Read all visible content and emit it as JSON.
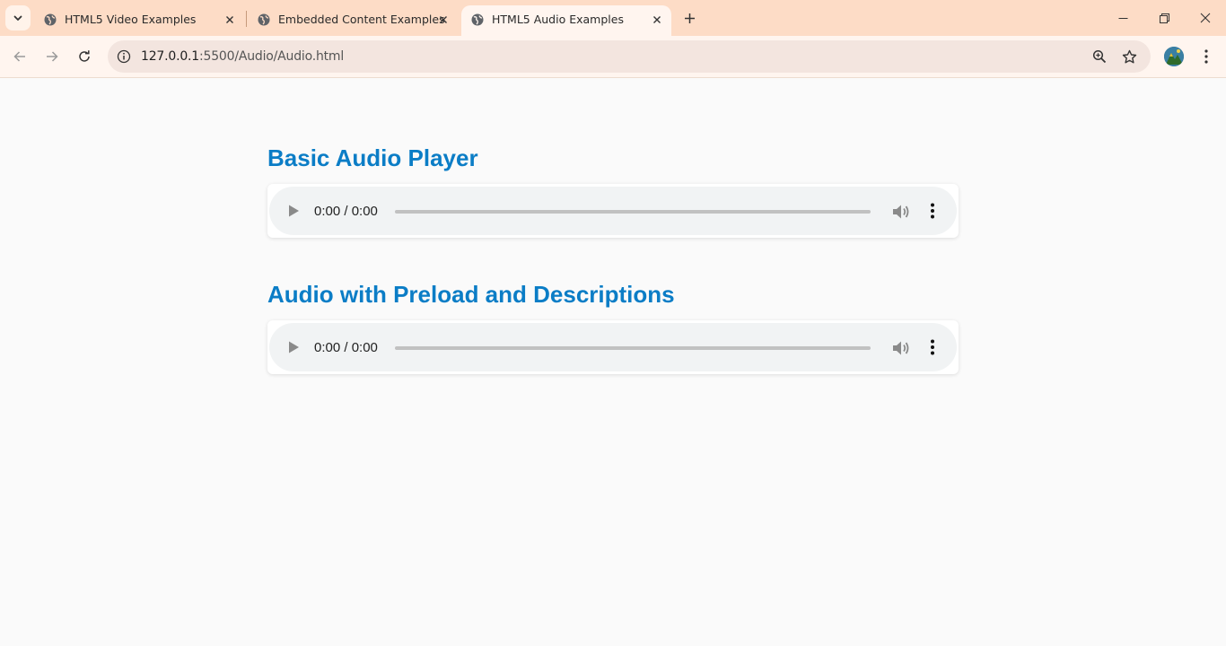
{
  "browser": {
    "tabs": [
      {
        "title": "HTML5 Video Examples",
        "active": false
      },
      {
        "title": "Embedded Content Examples",
        "active": false
      },
      {
        "title": "HTML5 Audio Examples",
        "active": true
      }
    ],
    "url_host": "127.0.0.1",
    "url_rest": ":5500/Audio/Audio.html",
    "colors": {
      "tabstrip": "#fddcc6",
      "toolbar": "#fff5ef",
      "omnibox": "#f3e5df"
    }
  },
  "page": {
    "sections": [
      {
        "heading": "Basic Audio Player",
        "player": {
          "time": "0:00 / 0:00"
        }
      },
      {
        "heading": "Audio with Preload and Descriptions",
        "player": {
          "time": "0:00 / 0:00"
        }
      }
    ],
    "heading_color": "#0b7dc6"
  }
}
